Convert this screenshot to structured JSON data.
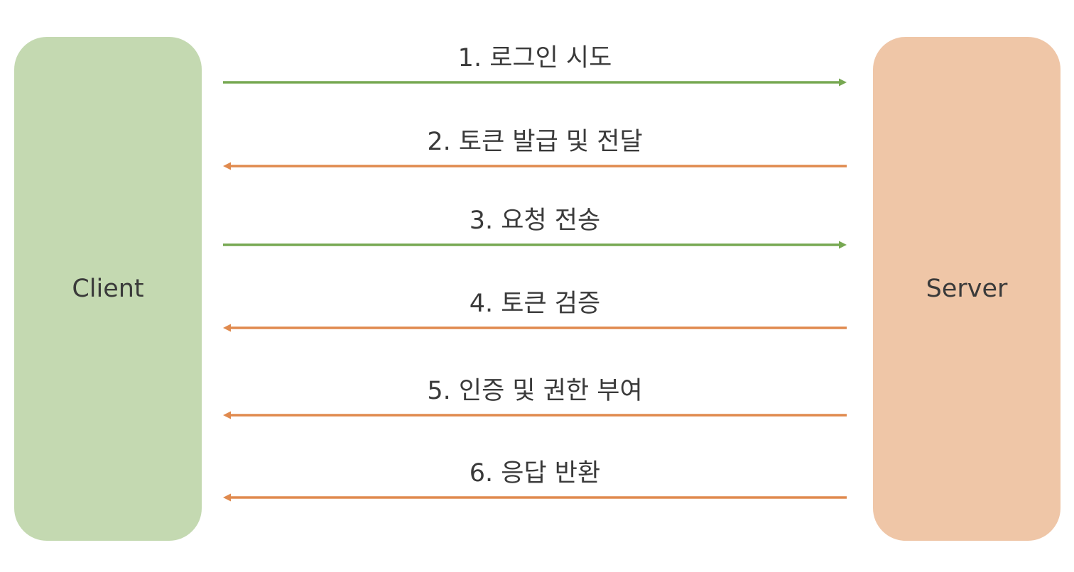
{
  "actors": {
    "client": {
      "label": "Client",
      "color": "#c4d9b1"
    },
    "server": {
      "label": "Server",
      "color": "#efc6a7"
    }
  },
  "colors": {
    "request_arrow": "#77a852",
    "response_arrow": "#e08a4e"
  },
  "steps": [
    {
      "label": "1. 로그인 시도",
      "direction": "client-to-server"
    },
    {
      "label": "2. 토큰 발급 및 전달",
      "direction": "server-to-client"
    },
    {
      "label": "3. 요청 전송",
      "direction": "client-to-server"
    },
    {
      "label": "4. 토큰 검증",
      "direction": "server-to-client"
    },
    {
      "label": "5. 인증 및 권한 부여",
      "direction": "server-to-client"
    },
    {
      "label": "6. 응답 반환",
      "direction": "server-to-client"
    }
  ]
}
